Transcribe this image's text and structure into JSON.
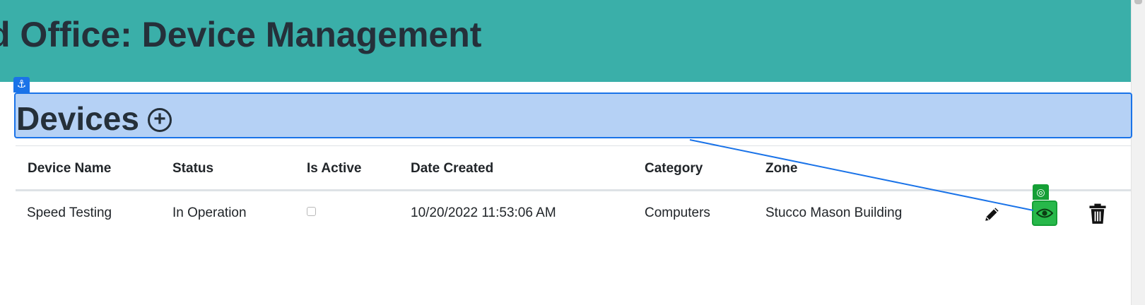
{
  "header": {
    "title": "d Office: Device Management"
  },
  "section": {
    "title": "Devices",
    "add_icon": "plus-circle-icon"
  },
  "table": {
    "columns": [
      "Device Name",
      "Status",
      "Is Active",
      "Date Created",
      "Category",
      "Zone"
    ],
    "rows": [
      {
        "device_name": "Speed Testing",
        "status": "In Operation",
        "is_active": false,
        "date_created": "10/20/2022 11:53:06 AM",
        "category": "Computers",
        "zone": "Stucco Mason Building",
        "actions": [
          "pencil-icon",
          "eye-icon",
          "trash-icon"
        ]
      }
    ]
  },
  "overlay": {
    "anchor_icon": "anchor-icon",
    "anchor_glyph": "⚓",
    "target_icon": "target-icon",
    "target_glyph": "◎"
  },
  "colors": {
    "header_bg": "#3aafa9",
    "highlight_bg": "#b5d1f5",
    "highlight_border": "#1a73e8",
    "view_button_bg": "#27b84a"
  }
}
